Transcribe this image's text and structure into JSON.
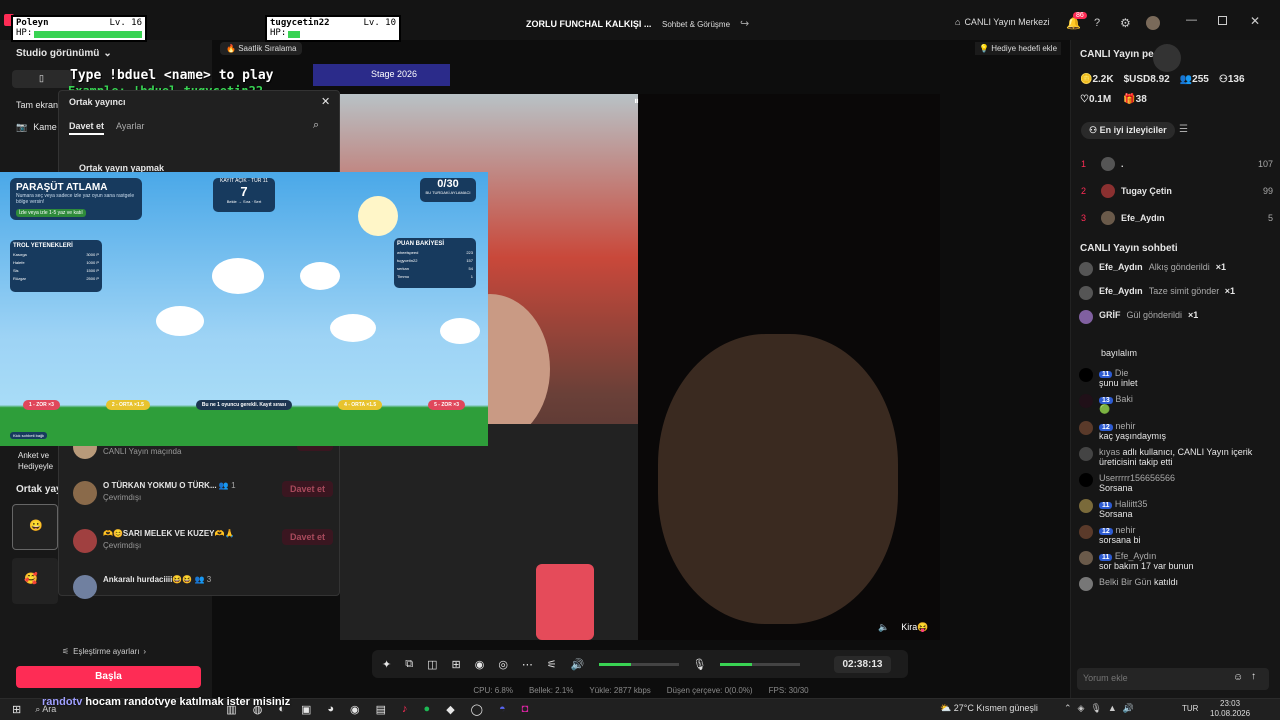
{
  "window": {
    "title": "ZORLU FUNCHAL KALKIŞI ...",
    "chat_tab": "Sohbet & Görüşme",
    "live_center": "CANLI Yayın Merkezi",
    "notif_count": "86"
  },
  "overlay": {
    "p1_name": "Poleyn",
    "p1_lv": "Lv. 16",
    "p1_hp": "HP:",
    "p2_name": "tugycetin22",
    "p2_lv": "Lv. 10",
    "p2_hp": "HP:",
    "duel_line1": "Type !bduel <name> to play",
    "duel_line2": "Example: !bduel tugycetin22",
    "ranking": "Saatlik Sıralama",
    "stage": "Stage 2026",
    "gift_goal": "Hediye hedefi ekle"
  },
  "left": {
    "studio_view": "Studio görünümü",
    "fullscreen": "Tam ekran",
    "camera": "Kame",
    "poll": "Anket ve",
    "gift": "Hediyeyle",
    "cohost": "Ortak yay",
    "match_settings": "Eşleştirme ayarları",
    "start": "Başla"
  },
  "cohost_panel": {
    "title": "Ortak yayıncı",
    "tab_invite": "Davet et",
    "tab_settings": "Ayarlar",
    "section": "Ortak yayın yapmak",
    "rows": [
      {
        "name": "cansinaslan8",
        "count": "1",
        "status": "CANLI Yayın maçında",
        "action": "Katıl"
      },
      {
        "name": "O TÜRKAN YOKMU O TÜRK...",
        "count": "1",
        "status": "Çevrimdışı",
        "action": "Davet et"
      },
      {
        "name": "🫶😊SARI MELEK VE KUZEY🫶🙏",
        "count": "",
        "status": "Çevrimdışı",
        "action": "Davet et"
      },
      {
        "name": "Ankaralı hurdaciiii😆😆",
        "count": "3",
        "status": "",
        "action": ""
      }
    ]
  },
  "game": {
    "title": "PARAŞÜT ATLAMA",
    "subtitle": "Numara seç veya sadece izle yaz oyun sana rastgele bölge versin!",
    "hint": "İzle veya izle 1-5 yaz ve katıl",
    "round_label": "KAYIT AÇIK · TUR 11",
    "round_value": "7",
    "round_sub": "Bekle → Sıra · Sert",
    "score": "0/30",
    "score_sub": "BU TURDAKİ AYLAMACI",
    "troll_title": "TROL YETENEKLERİ",
    "troll_rows": [
      [
        "Kasırga",
        "3000 P"
      ],
      [
        "Halefe",
        "1000 P"
      ],
      [
        "Sis",
        "1500 P"
      ],
      [
        "Rüzgar",
        "2500 P"
      ]
    ],
    "points_title": "PUAN BAKİYESİ",
    "points_rows": [
      [
        "wheelspeed",
        "223"
      ],
      [
        "tugycetin22",
        "157"
      ],
      [
        "serkan",
        "54"
      ],
      [
        "Timmo",
        "1"
      ]
    ],
    "zones": [
      "1 - ZOR ×3",
      "2 - ORTA ×1.5",
      "Bu ne 1 oyuncu gerekli. Kayıt sırası",
      "4 - ORTA ×1.5",
      "5 - ZOR ×3"
    ],
    "footer": "Kick sohbeti bağlı"
  },
  "video": {
    "label": "Kira😝"
  },
  "controls": {
    "timer": "02:38:13"
  },
  "status": {
    "cpu": "CPU:  6.8%",
    "mem": "Bellek:  2.1%",
    "upload": "Yükle:  2877 kbps",
    "drop": "Düşen çerçeve:  0(0.0%)",
    "fps": "FPS:  30/30"
  },
  "right": {
    "live_title": "CANLI Yayın pe",
    "stat_coins": "2.2K",
    "stat_usd": "USD8.92",
    "stat_viewers": "255",
    "stat_followers": "136",
    "stat_likes": "0.1M",
    "stat_gifts": "38",
    "top_viewers": "En iyi izleyiciler",
    "top": [
      {
        "rank": "1",
        "name": ".",
        "score": "107"
      },
      {
        "rank": "2",
        "name": "Tugay Çetin",
        "score": "99"
      },
      {
        "rank": "3",
        "name": "Efe_Aydın",
        "score": "5"
      }
    ],
    "chat_title": "CANLI Yayın sohbeti",
    "gift_events": [
      {
        "user": "Efe_Aydın",
        "text": "Alkış gönderildi",
        "mult": "×1"
      },
      {
        "user": "Efe_Aydın",
        "text": "Taze simit gönderildi",
        "mult": "×1"
      },
      {
        "user": "GRİF",
        "text": "Gül gönderildi",
        "mult": "×1"
      }
    ],
    "messages": [
      {
        "lvl": "",
        "user": "",
        "text": "bayılalım"
      },
      {
        "lvl": "11",
        "user": "Die",
        "text": "şunu inlet"
      },
      {
        "lvl": "13",
        "user": "Baki",
        "text": "🟢"
      },
      {
        "lvl": "12",
        "user": "nehir",
        "text": "kaç yaşındaymış"
      },
      {
        "lvl": "",
        "user": "kıyas",
        "text": "adlı kullanıcı, CANLI Yayın içerik üreticisini takip etti"
      },
      {
        "lvl": "",
        "user": "Userrrrr156656566",
        "text": "Sorsana"
      },
      {
        "lvl": "11",
        "user": "Haliitt35",
        "text": "Sorsana"
      },
      {
        "lvl": "12",
        "user": "nehir",
        "text": "sorsana bi"
      },
      {
        "lvl": "11",
        "user": "Efe_Aydın",
        "text": "sor bakım 17 var bunun"
      },
      {
        "lvl": "",
        "user": "Belki Bir Gün",
        "text": "katıldı"
      }
    ],
    "comment_placeholder": "Yorum ekle"
  },
  "taskbar": {
    "search": "Ara",
    "ticker": "hocam randotvye katılmak ister misiniz",
    "ticker_user": "randotv",
    "weather": "27°C  Kısmen güneşli",
    "lang": "TUR",
    "time": "23:03",
    "date": "10.08.2026"
  },
  "colors": {
    "accent": "#fe2c55",
    "green": "#39d353",
    "bg": "#101010"
  }
}
